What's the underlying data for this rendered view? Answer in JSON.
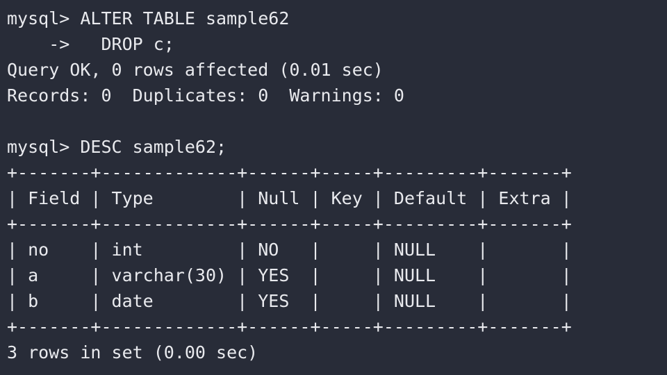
{
  "terminal": {
    "prompt": "mysql>",
    "continuation": "->",
    "background_color": "#282c38",
    "foreground_color": "#e9eaee",
    "lines": [
      "mysql> ALTER TABLE sample62",
      "    ->   DROP c;",
      "Query OK, 0 rows affected (0.01 sec)",
      "Records: 0  Duplicates: 0  Warnings: 0",
      "",
      "mysql> DESC sample62;",
      "+-------+-------------+------+-----+---------+-------+",
      "| Field | Type        | Null | Key | Default | Extra |",
      "+-------+-------------+------+-----+---------+-------+",
      "| no    | int         | NO   |     | NULL    |       |",
      "| a     | varchar(30) | YES  |     | NULL    |       |",
      "| b     | date        | YES  |     | NULL    |       |",
      "+-------+-------------+------+-----+---------+-------+",
      "3 rows in set (0.00 sec)"
    ]
  },
  "commands": {
    "alter_statement": "ALTER TABLE sample62",
    "drop_clause": "DROP c;",
    "desc_statement": "DESC sample62;"
  },
  "results": {
    "alter_status": "Query OK, 0 rows affected (0.01 sec)",
    "alter_counters": "Records: 0  Duplicates: 0  Warnings: 0",
    "records": "0",
    "duplicates": "0",
    "warnings": "0",
    "alter_duration": "0.01 sec",
    "row_count_status": "3 rows in set (0.00 sec)",
    "row_count": "3",
    "desc_duration": "0.00 sec"
  },
  "describe_table": {
    "table_name": "sample62",
    "columns": [
      "Field",
      "Type",
      "Null",
      "Key",
      "Default",
      "Extra"
    ],
    "rows": [
      {
        "Field": "no",
        "Type": "int",
        "Null": "NO",
        "Key": "",
        "Default": "NULL",
        "Extra": ""
      },
      {
        "Field": "a",
        "Type": "varchar(30)",
        "Null": "YES",
        "Key": "",
        "Default": "NULL",
        "Extra": ""
      },
      {
        "Field": "b",
        "Type": "date",
        "Null": "YES",
        "Key": "",
        "Default": "NULL",
        "Extra": ""
      }
    ],
    "border": "+-------+-------------+------+-----+---------+-------+",
    "header_row": "| Field | Type        | Null | Key | Default | Extra |",
    "data_rows": [
      "| no    | int         | NO   |     | NULL    |       |",
      "| a     | varchar(30) | YES  |     | NULL    |       |",
      "| b     | date        | YES  |     | NULL    |       |"
    ]
  }
}
